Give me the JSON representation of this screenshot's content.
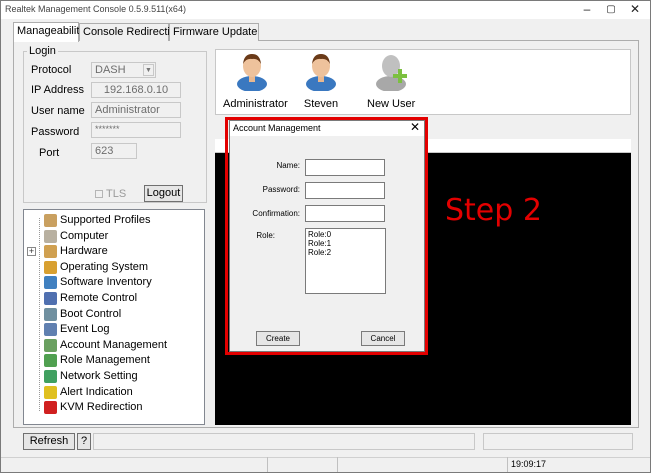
{
  "window": {
    "title": "Realtek Management Console 0.5.9.511(x64)",
    "controls": [
      "–",
      "▢",
      "✕"
    ]
  },
  "tabs": [
    {
      "label": "Manageability",
      "active": true
    },
    {
      "label": "Console Redirection",
      "active": false
    },
    {
      "label": "Firmware Update",
      "active": false
    }
  ],
  "login": {
    "legend": "Login",
    "protocol_label": "Protocol",
    "protocol_value": "DASH",
    "ip_label": "IP Address",
    "ip_value": "192.168.0.10",
    "user_label": "User name",
    "user_value": "Administrator",
    "password_label": "Password",
    "password_value": "*******",
    "port_label": "Port",
    "port_value": "623",
    "tls_label": "TLS",
    "logout_label": "Logout"
  },
  "tree": {
    "items": [
      {
        "label": "Supported Profiles",
        "icon": "profiles-icon",
        "color": "#c9a060"
      },
      {
        "label": "Computer",
        "icon": "computer-icon",
        "color": "#b8b0a0"
      },
      {
        "label": "Hardware",
        "icon": "hardware-icon",
        "color": "#d0a050",
        "expander": "+"
      },
      {
        "label": "Operating System",
        "icon": "os-icon",
        "color": "#d8a030"
      },
      {
        "label": "Software Inventory",
        "icon": "software-icon",
        "color": "#4080c0"
      },
      {
        "label": "Remote Control",
        "icon": "remote-icon",
        "color": "#5070b0"
      },
      {
        "label": "Boot Control",
        "icon": "boot-icon",
        "color": "#7090a0"
      },
      {
        "label": "Event Log",
        "icon": "eventlog-icon",
        "color": "#6080b0"
      },
      {
        "label": "Account Management",
        "icon": "account-icon",
        "color": "#6aa060"
      },
      {
        "label": "Role Management",
        "icon": "role-icon",
        "color": "#50a050"
      },
      {
        "label": "Network Setting",
        "icon": "network-icon",
        "color": "#40a060"
      },
      {
        "label": "Alert Indication",
        "icon": "alert-icon",
        "color": "#e0c020"
      },
      {
        "label": "KVM Redirection",
        "icon": "kvm-icon",
        "color": "#d02020"
      }
    ]
  },
  "users": [
    {
      "name": "Administrator",
      "icon": "user-admin-icon"
    },
    {
      "name": "Steven",
      "icon": "user-steven-icon"
    },
    {
      "name": "New User",
      "icon": "new-user-icon"
    }
  ],
  "dialog": {
    "title": "Account Management",
    "close": "✕",
    "name_label": "Name:",
    "password_label": "Password:",
    "confirmation_label": "Confirmation:",
    "role_label": "Role:",
    "roles": [
      "Role:0",
      "Role:1",
      "Role:2"
    ],
    "create_label": "Create",
    "cancel_label": "Cancel"
  },
  "annotation": {
    "text": "Step 2",
    "color": "#e30000"
  },
  "bottom": {
    "refresh_label": "Refresh",
    "help_label": "?",
    "time": "19:09:17"
  }
}
